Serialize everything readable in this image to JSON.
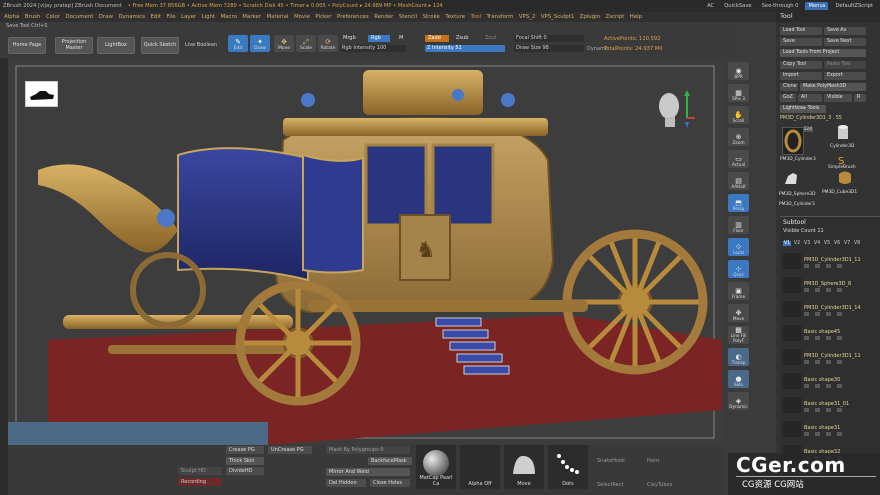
{
  "titlebar": {
    "title": "ZBrush 2024 [vijay pratap]   ZBrush Document",
    "stats": "• Free Mem 37.856GB • Active Mem 7280 • Scratch Disk 45 • Timer ▸ 0.005 • PolyCount ▸ 24.989 MP • MeshCount ▸ 124",
    "ac": "AC",
    "quicksave": "QuickSave",
    "seethrough": "See-through   0",
    "menus": "Menus",
    "script": "DefaultZScript"
  },
  "menubar": [
    "Alpha",
    "Brush",
    "Color",
    "Document",
    "Draw",
    "Dynamics",
    "Edit",
    "File",
    "Layer",
    "Light",
    "Macro",
    "Marker",
    "Material",
    "Movie",
    "Picker",
    "Preferences",
    "Render",
    "Stencil",
    "Stroke",
    "Texture",
    "Tool",
    "Transform",
    "VPS_2",
    "VPS_Sculpt1",
    "Zplugin",
    "Zscript",
    "Help"
  ],
  "hint": "Save Tool Ctrl+S",
  "toolbar": {
    "home": "Home Page",
    "projection": "Projection Master",
    "lightbox": "LightBox",
    "quicksketch": "Quick Sketch",
    "livebool": "Live Boolean",
    "edit": "Edit",
    "draw": "Draw",
    "move": "Move",
    "scale": "Scale",
    "rotate": "Rotate",
    "mrgb": "Mrgb",
    "rgb": "Rgb",
    "m": "M",
    "rgb_intensity": "Rgb Intensity 100",
    "zadd": "Zadd",
    "zsub": "Zsub",
    "zcut": "Zcut",
    "z_intensity": "Z Intensity 51",
    "focal_shift": "Focal Shift 0",
    "draw_size": "Draw Size 98",
    "dynamic": "Dynamic",
    "active_points": "ActivePoints: 110,592",
    "total_points": "TotalPoints: 24.937 Mil"
  },
  "right_shelf": [
    {
      "label": "BPR",
      "icon": "render-sphere-icon"
    },
    {
      "label": "SPix 3",
      "icon": "spix-icon"
    },
    {
      "label": "Scroll",
      "icon": "hand-icon"
    },
    {
      "label": "Zoom",
      "icon": "zoom-icon"
    },
    {
      "label": "Actual",
      "icon": "actual-icon"
    },
    {
      "label": "AAHalf",
      "icon": "aahalf-icon"
    },
    {
      "label": "Persp",
      "icon": "persp-icon"
    },
    {
      "label": "Floor",
      "icon": "floor-icon"
    },
    {
      "label": "Local",
      "icon": "local-icon"
    },
    {
      "label": "Qxyz",
      "icon": "axis-icon"
    },
    {
      "label": "Frame",
      "icon": "frame-icon"
    },
    {
      "label": "Move",
      "icon": "move-icon"
    },
    {
      "label": "Line Fill PolyF",
      "icon": "polyframe-icon"
    },
    {
      "label": "Transp",
      "icon": "transp-icon"
    },
    {
      "label": "Solo",
      "icon": "solo-icon"
    },
    {
      "label": "Dynamic",
      "icon": "dynamic-icon"
    }
  ],
  "tool": {
    "header": "Tool",
    "load_tool": "Load Tool",
    "save_as": "Save As",
    "save": "Save",
    "save_next": "Save Next",
    "load_from_project": "Load Tools From Project",
    "copy_tool": "Copy Tool",
    "paste_tool": "Paste Tool",
    "import": "Import",
    "export": "Export",
    "clone": "Clone",
    "make_polymesh": "Make PolyMesh3D",
    "goz": "GoZ",
    "all": "All",
    "visible": "Visible",
    "r": "R",
    "lightbox_tools": "Lightbox▸ Tools",
    "current_tool": "PM3D_Cylinder3D1_3 . 55",
    "thumbs": [
      {
        "name": "PM3D_Cylinder3",
        "count": "124"
      },
      {
        "name": "Cylinder3D",
        "count": ""
      },
      {
        "name": "SimpleBrush",
        "count": ""
      },
      {
        "name": "PM3D_Sphere3D",
        "count": ""
      },
      {
        "name": "PM3D_Cube3D1",
        "count": ""
      },
      {
        "name": "PM3D_Cylinder3",
        "count": ""
      }
    ]
  },
  "subtool": {
    "header": "Subtool",
    "visible_count": "Visible Count 11",
    "tabs": [
      "V1",
      "V2",
      "V3",
      "V4",
      "V5",
      "V6",
      "V7",
      "V8"
    ],
    "items": [
      "PM3D_Cylinder3D1_11",
      "PM3D_Sphere3D_8",
      "PM3D_Cylinder3D1_14",
      "Basic shape45",
      "PM3D_Cylinder3D1_11",
      "Basic shape30",
      "Basic shape31_01",
      "Basic shape31",
      "Basic shape32"
    ]
  },
  "bottom": {
    "crease_pg": "Crease PG",
    "uncrease_pg": "UnCrease PG",
    "thick_skin": "Thick Skin",
    "dividehd": "DivideHD",
    "sculpt_hd": "Sculpt HD",
    "rendering": "Recording",
    "mask_polygroups": "Mask By Polygroups  0",
    "backface_mask": "BackfaceMask",
    "mirror_weld": "Mirror And Weld",
    "del_hidden": "Del Hidden",
    "close_holes": "Close Holes",
    "slots": [
      {
        "label": "MatCap Pearl Ca",
        "icon": "matcap-sphere-icon"
      },
      {
        "label": "Alpha Off",
        "icon": "alpha-off-icon"
      },
      {
        "label": "Move",
        "icon": "move-brush-icon"
      },
      {
        "label": "Dots",
        "icon": "dots-stroke-icon"
      }
    ],
    "snakehook": "SnakeHook",
    "paint": "Paint",
    "selectrect": "SelectRect",
    "claytubes": "ClayTubes"
  },
  "watermark": {
    "big": "CGer.com",
    "small": "CG资源 CG网站"
  },
  "colors": {
    "accent": "#3d78c2",
    "orange": "#c4721c",
    "floor": "#7a2424",
    "gold": "#b88a3c",
    "fabric": "#2a3580"
  }
}
